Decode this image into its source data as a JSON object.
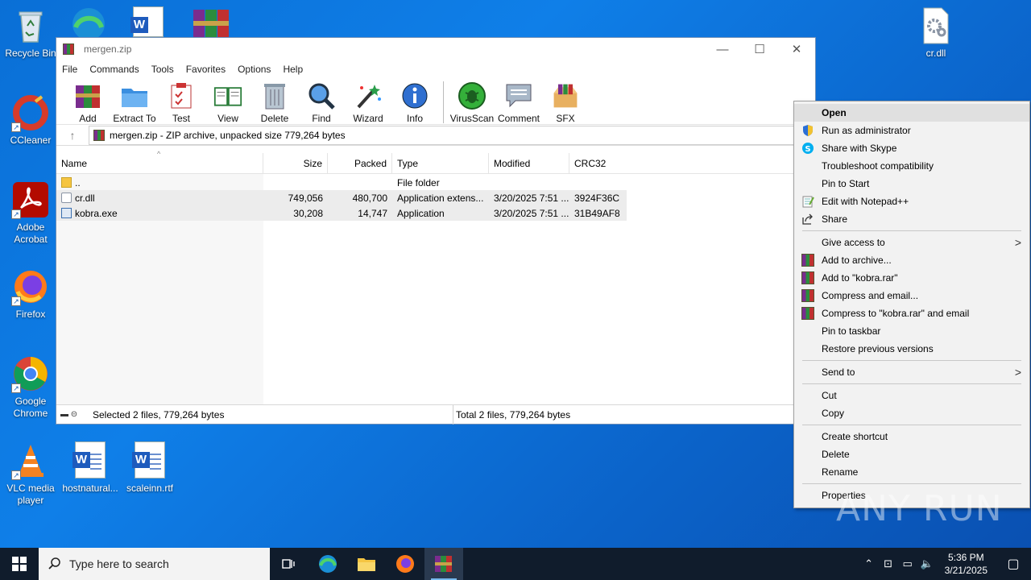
{
  "desktop": {
    "icons": [
      {
        "label": "Recycle Bin"
      },
      {
        "label": "CCleaner"
      },
      {
        "label": "Adobe Acrobat"
      },
      {
        "label": "Firefox"
      },
      {
        "label": "Google Chrome"
      },
      {
        "label": "VLC media player"
      },
      {
        "label": "hostnatural..."
      },
      {
        "label": "scaleinn.rtf"
      },
      {
        "label": "cr.dll"
      }
    ]
  },
  "window": {
    "title": "mergen.zip",
    "menu": [
      "File",
      "Commands",
      "Tools",
      "Favorites",
      "Options",
      "Help"
    ],
    "toolbar": [
      "Add",
      "Extract To",
      "Test",
      "View",
      "Delete",
      "Find",
      "Wizard",
      "Info",
      "VirusScan",
      "Comment",
      "SFX"
    ],
    "address": "mergen.zip - ZIP archive, unpacked size 779,264 bytes",
    "columns": {
      "name": "Name",
      "size": "Size",
      "packed": "Packed",
      "type": "Type",
      "modified": "Modified",
      "crc": "CRC32"
    },
    "rows": [
      {
        "name": "..",
        "size": "",
        "packed": "",
        "type": "File folder",
        "modified": "",
        "crc": ""
      },
      {
        "name": "cr.dll",
        "size": "749,056",
        "packed": "480,700",
        "type": "Application extens...",
        "modified": "3/20/2025 7:51 ...",
        "crc": "3924F36C"
      },
      {
        "name": "kobra.exe",
        "size": "30,208",
        "packed": "14,747",
        "type": "Application",
        "modified": "3/20/2025 7:51 ...",
        "crc": "31B49AF8"
      }
    ],
    "status_left": "Selected 2 files, 779,264 bytes",
    "status_right": "Total 2 files, 779,264 bytes"
  },
  "context_menu": {
    "items": [
      {
        "label": "Open"
      },
      {
        "label": "Run as administrator"
      },
      {
        "label": "Share with Skype"
      },
      {
        "label": "Troubleshoot compatibility"
      },
      {
        "label": "Pin to Start"
      },
      {
        "label": "Edit with Notepad++"
      },
      {
        "label": "Share"
      },
      {
        "label": "Give access to"
      },
      {
        "label": "Add to archive..."
      },
      {
        "label": "Add to \"kobra.rar\""
      },
      {
        "label": "Compress and email..."
      },
      {
        "label": "Compress to \"kobra.rar\" and email"
      },
      {
        "label": "Pin to taskbar"
      },
      {
        "label": "Restore previous versions"
      },
      {
        "label": "Send to"
      },
      {
        "label": "Cut"
      },
      {
        "label": "Copy"
      },
      {
        "label": "Create shortcut"
      },
      {
        "label": "Delete"
      },
      {
        "label": "Rename"
      },
      {
        "label": "Properties"
      }
    ]
  },
  "taskbar": {
    "search_placeholder": "Type here to search",
    "time": "5:36 PM",
    "date": "3/21/2025"
  },
  "watermark": "ANY RUN",
  "colors": {
    "desktop": "#0f7fe8",
    "taskbar": "#101c2c",
    "selection": "#ececec"
  }
}
